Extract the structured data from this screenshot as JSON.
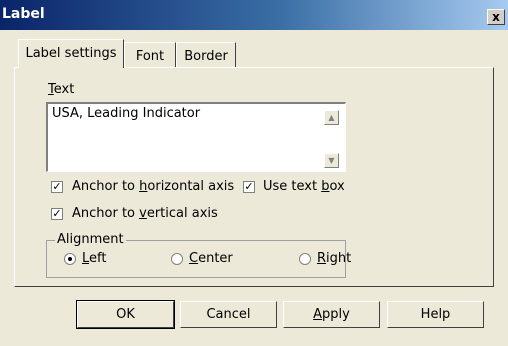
{
  "window": {
    "title": "Label",
    "close_glyph": "x"
  },
  "tabs": [
    {
      "label": "Label settings",
      "active": true
    },
    {
      "label": "Font",
      "active": false
    },
    {
      "label": "Border",
      "active": false
    }
  ],
  "text_section": {
    "label_first": "T",
    "label_rest": "ext",
    "value": "USA, Leading Indicator"
  },
  "options": {
    "anchor_horizontal": {
      "pre": "Anchor to ",
      "key": "h",
      "post": "orizontal axis",
      "checked": true
    },
    "use_text_box": {
      "pre": "Use text ",
      "key": "b",
      "post": "ox",
      "checked": true
    },
    "anchor_vertical": {
      "pre": "Anchor to ",
      "key": "v",
      "post": "ertical axis",
      "checked": true
    }
  },
  "alignment": {
    "title": "Alignment",
    "options": [
      {
        "key": "L",
        "rest": "eft",
        "selected": true
      },
      {
        "key": "C",
        "rest": "enter",
        "selected": false
      },
      {
        "key": "R",
        "rest": "ight",
        "selected": false
      }
    ]
  },
  "buttons": {
    "ok": "OK",
    "cancel": "Cancel",
    "apply_key": "A",
    "apply_rest": "pply",
    "help": "Help"
  },
  "colors": {
    "title_gradient_start": "#0a246a",
    "title_gradient_end": "#a6caf0",
    "dialog_bg": "#ece9d8"
  }
}
